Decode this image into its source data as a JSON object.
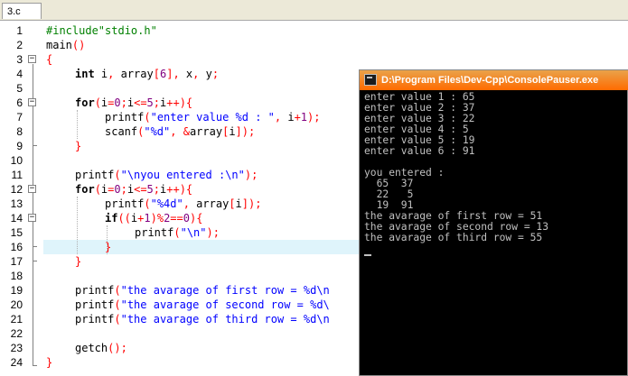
{
  "tab": {
    "label": "3.c"
  },
  "code_lines": [
    {
      "n": "1"
    },
    {
      "n": "2"
    },
    {
      "n": "3"
    },
    {
      "n": "4"
    },
    {
      "n": "5"
    },
    {
      "n": "6"
    },
    {
      "n": "7"
    },
    {
      "n": "8"
    },
    {
      "n": "9"
    },
    {
      "n": "10"
    },
    {
      "n": "11"
    },
    {
      "n": "12"
    },
    {
      "n": "13"
    },
    {
      "n": "14"
    },
    {
      "n": "15"
    },
    {
      "n": "16"
    },
    {
      "n": "17"
    },
    {
      "n": "18"
    },
    {
      "n": "19"
    },
    {
      "n": "20"
    },
    {
      "n": "21"
    },
    {
      "n": "22"
    },
    {
      "n": "23"
    },
    {
      "n": "24"
    }
  ],
  "code": {
    "l1_include": "#include\"stdio.h\"",
    "l2_main": "main",
    "l2_paren": "()",
    "l3_brace": "{",
    "l4_int": "int",
    "l4_rest_a": " i",
    "l4_comma1": ",",
    "l4_rest_b": " array",
    "l4_br1": "[",
    "l4_num": "6",
    "l4_br2": "]",
    "l4_comma2": ",",
    "l4_rest_c": " x",
    "l4_comma3": ",",
    "l4_rest_d": " y",
    "l4_semi": ";",
    "l6_for": "for",
    "l6_a": "(",
    "l6_b": "i",
    "l6_c": "=",
    "l6_d": "0",
    "l6_e": ";",
    "l6_f": "i",
    "l6_g": "<=",
    "l6_h": "5",
    "l6_i": ";",
    "l6_j": "i",
    "l6_k": "++){",
    "l7_fn": "printf",
    "l7_p": "(",
    "l7_str": "\"enter value %d : \"",
    "l7_c": ",",
    "l7_i": " i",
    "l7_plus": "+",
    "l7_one": "1",
    "l7_end": ");",
    "l8_fn": "scanf",
    "l8_p": "(",
    "l8_str": "\"%d\"",
    "l8_c": ",",
    "l8_amp": " &",
    "l8_arr": "array",
    "l8_b1": "[",
    "l8_i": "i",
    "l8_b2": "]);",
    "l9_brace": "}",
    "l11_fn": "printf",
    "l11_p": "(",
    "l11_str": "\"\\nyou entered :\\n\"",
    "l11_end": ");",
    "l12_for": "for",
    "l12_a": "(",
    "l12_b": "i",
    "l12_c": "=",
    "l12_d": "0",
    "l12_e": ";",
    "l12_f": "i",
    "l12_g": "<=",
    "l12_h": "5",
    "l12_i": ";",
    "l12_j": "i",
    "l12_k": "++){",
    "l13_fn": "printf",
    "l13_p": "(",
    "l13_str": "\"%4d\"",
    "l13_c": ",",
    "l13_arr": " array",
    "l13_b1": "[",
    "l13_i": "i",
    "l13_b2": "]);",
    "l14_if": "if",
    "l14_a": "((",
    "l14_i": "i",
    "l14_plus": "+",
    "l14_one": "1",
    "l14_b": ")%",
    "l14_two": "2",
    "l14_eq": "==",
    "l14_zero": "0",
    "l14_c": "){",
    "l15_fn": "printf",
    "l15_p": "(",
    "l15_str": "\"\\n\"",
    "l15_end": ");",
    "l16_brace": "}",
    "l17_brace": "}",
    "l19_fn": "printf",
    "l19_p": "(",
    "l19_str": "\"the avarage of first row = %d\\n",
    "l20_fn": "printf",
    "l20_p": "(",
    "l20_str": "\"the avarage of second row = %d\\",
    "l21_fn": "printf",
    "l21_p": "(",
    "l21_str": "\"the avarage of third row = %d\\n",
    "l23_fn": "getch",
    "l23_end": "();",
    "l24_brace": "}"
  },
  "console": {
    "title": "D:\\Program Files\\Dev-Cpp\\ConsolePauser.exe",
    "lines": [
      "enter value 1 : 65",
      "enter value 2 : 37",
      "enter value 3 : 22",
      "enter value 4 : 5",
      "enter value 5 : 19",
      "enter value 6 : 91",
      "",
      "you entered :",
      "  65  37",
      "  22   5",
      "  19  91",
      "the avarage of first row = 51",
      "the avarage of second row = 13",
      "the avarage of third row = 55"
    ]
  }
}
